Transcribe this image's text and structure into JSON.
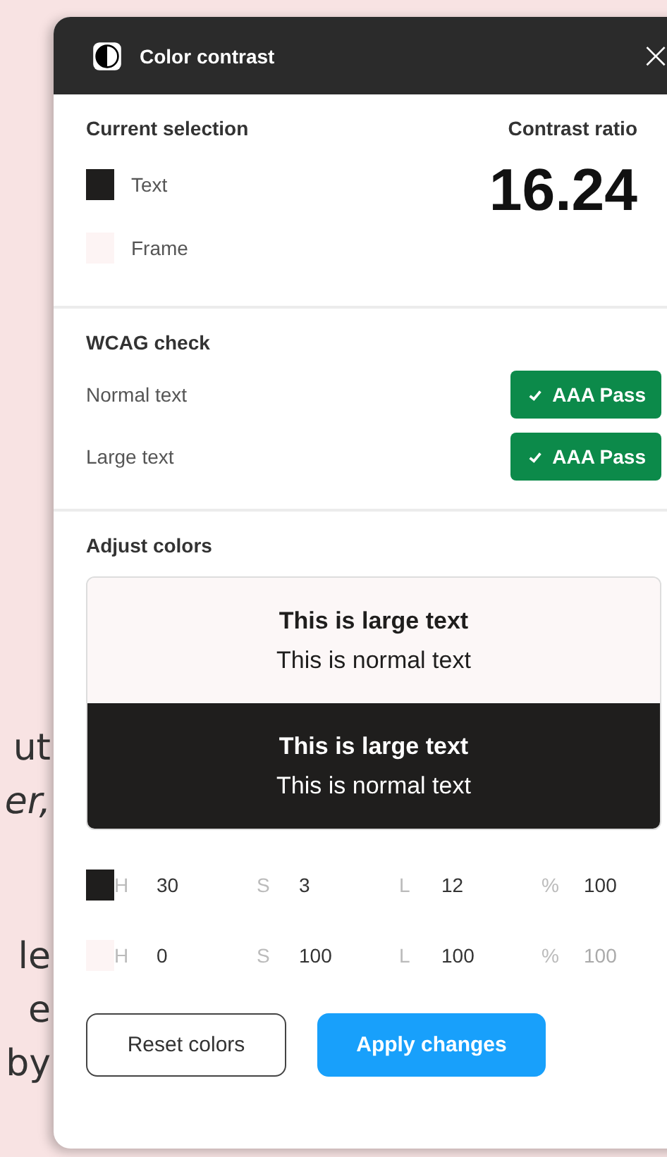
{
  "background_text": [
    {
      "text": "ut",
      "italic": false
    },
    {
      "text": "er,",
      "italic": true
    },
    {
      "text": "le",
      "italic": false
    },
    {
      "text": "e",
      "italic": false
    },
    {
      "text": "by",
      "italic": false
    }
  ],
  "window": {
    "title": "Color contrast",
    "close": "×"
  },
  "current_selection": {
    "title": "Current selection",
    "items": [
      {
        "label": "Text",
        "color": "#1f1e1d"
      },
      {
        "label": "Frame",
        "color": "#fdf4f4"
      }
    ]
  },
  "contrast_ratio": {
    "label": "Contrast ratio",
    "value": "16.24"
  },
  "wcag_check": {
    "title": "WCAG check",
    "rows": [
      {
        "label": "Normal text",
        "result": "AAA Pass",
        "pass": true
      },
      {
        "label": "Large text",
        "result": "AAA Pass",
        "pass": true
      }
    ]
  },
  "adjust_colors": {
    "title": "Adjust colors",
    "previews": [
      {
        "kind": "light",
        "color": "#fcf7f7",
        "large": "This is large text",
        "normal": "This is normal text"
      },
      {
        "kind": "dark",
        "color": "#1f1e1d",
        "large": "This is large text",
        "normal": "This is normal text"
      }
    ],
    "color_rows": [
      {
        "color": "#1f1e1d",
        "h_label": "H",
        "h": "30",
        "s_label": "S",
        "s": "3",
        "l_label": "L",
        "l": "12",
        "alpha_label": "%",
        "alpha": "100",
        "alpha_disabled": false
      },
      {
        "color": "#fdf4f4",
        "h_label": "H",
        "h": "0",
        "s_label": "S",
        "s": "100",
        "l_label": "L",
        "l": "100",
        "alpha_label": "%",
        "alpha": "100",
        "alpha_disabled": true
      }
    ]
  },
  "buttons": [
    {
      "label": "Reset colors",
      "kind": "secondary"
    },
    {
      "label": "Apply changes",
      "kind": "primary"
    }
  ]
}
